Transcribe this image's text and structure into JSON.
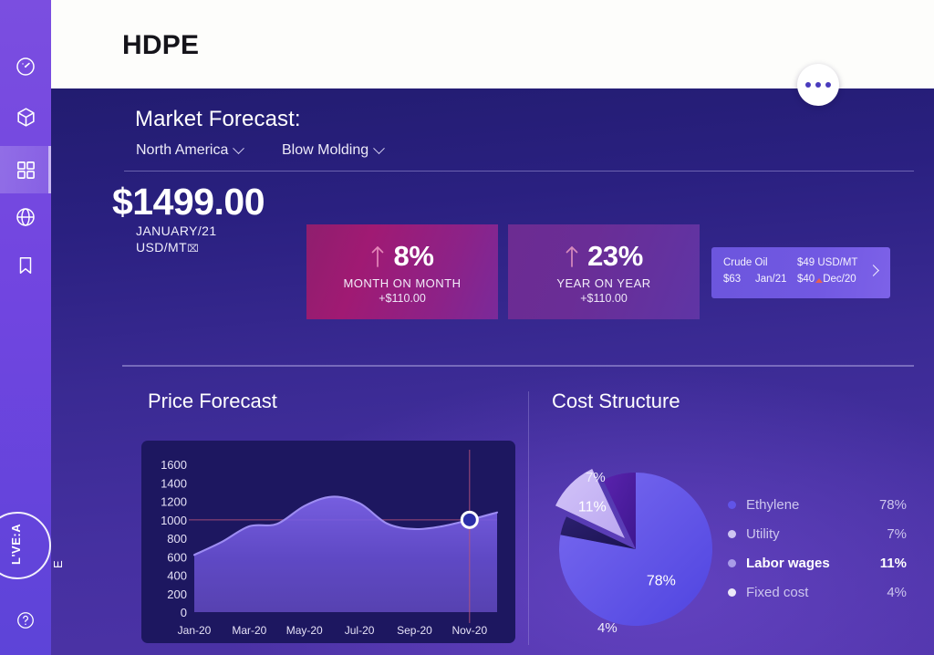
{
  "sidebar": {
    "items": [
      {
        "name": "dashboard",
        "icon": "gauge-icon",
        "active": false
      },
      {
        "name": "products",
        "icon": "cube-icon",
        "active": false
      },
      {
        "name": "grid",
        "icon": "grid-icon",
        "active": true
      },
      {
        "name": "global",
        "icon": "globe-icon",
        "active": false
      },
      {
        "name": "bookmarks",
        "icon": "bookmark-icon",
        "active": false
      }
    ],
    "logo": {
      "line1": "L'VE:A",
      "line2": "E"
    },
    "help_icon": "help-icon"
  },
  "header": {
    "title": "HDPE",
    "more_icon": "more-options-icon"
  },
  "forecast": {
    "title": "Market Forecast:",
    "region": "North America",
    "process": "Blow Molding",
    "price": "$1499.00",
    "period": "JANUARY/21",
    "unit": "USD/MT",
    "unit_glyph": "⌧"
  },
  "metrics": [
    {
      "id": "month-on-month",
      "percent": "8%",
      "label": "MONTH ON MONTH",
      "delta": "+$110.00",
      "direction": "up",
      "color": "#9a1c78"
    },
    {
      "id": "year-on-year",
      "percent": "23%",
      "label": "YEAR ON YEAR",
      "delta": "+$110.00",
      "direction": "up",
      "color": "#67309a"
    }
  ],
  "crude": {
    "name": "Crude Oil",
    "price": "$63",
    "date": "Jan/21",
    "alt_unit": "$49 USD/MT",
    "alt_price": "$40",
    "alt_date": "Dec/20",
    "trend": "up",
    "trend_color": "#e8604f",
    "chevron_icon": "chevron-right-icon"
  },
  "panels": {
    "price_forecast_title": "Price Forecast",
    "cost_structure_title": "Cost Structure"
  },
  "chart_data": [
    {
      "type": "line",
      "title": "Price Forecast",
      "xlabel": "",
      "ylabel": "",
      "ylim": [
        0,
        1700
      ],
      "yticks": [
        0,
        200,
        400,
        600,
        800,
        1000,
        1200,
        1400,
        1600
      ],
      "ytick_labels": [
        "0",
        "200",
        "400",
        "600",
        "800",
        "1000",
        "1200",
        "1400",
        "1600"
      ],
      "xtick_labels": [
        "Jan-20",
        "Mar-20",
        "May-20",
        "Jul-20",
        "Sep-20",
        "Nov-20"
      ],
      "grid": false,
      "series": [
        {
          "name": "Price",
          "color": "#8d7ced",
          "x": [
            "Jan-20",
            "Feb-20",
            "Mar-20",
            "Apr-20",
            "May-20",
            "Jun-20",
            "Jul-20",
            "Aug-20",
            "Sep-20",
            "Oct-20",
            "Nov-20",
            "Dec-20"
          ],
          "values": [
            620,
            760,
            930,
            955,
            1150,
            1250,
            1180,
            960,
            900,
            930,
            1000,
            1080
          ]
        }
      ],
      "reference_line": {
        "value": 1000,
        "color": "#b5547c"
      },
      "marker": {
        "x": "Nov-20",
        "y": 1000,
        "color": "#2b2ea8"
      },
      "cursor_line": {
        "x": "Nov-20",
        "color": "#b5547c"
      }
    },
    {
      "type": "pie",
      "title": "Cost Structure",
      "legend_position": "right",
      "categories": [
        "Ethylene",
        "Utility",
        "Labor wages",
        "Fixed cost"
      ],
      "values": [
        78,
        7,
        11,
        4
      ],
      "value_labels": [
        "78%",
        "7%",
        "11%",
        "4%"
      ],
      "colors": [
        "#6154e8",
        "#4b1f9e",
        "#c7b4f5",
        "#241a5e"
      ],
      "legend": [
        {
          "label": "Ethylene",
          "value": "78%",
          "dot": "#6154e8",
          "highlight": false
        },
        {
          "label": "Utility",
          "value": "7%",
          "dot": "#cec5f2",
          "highlight": false
        },
        {
          "label": "Labor wages",
          "value": "11%",
          "dot": "#a99ce8",
          "highlight": true
        },
        {
          "label": "Fixed cost",
          "value": "4%",
          "dot": "#ece9f8",
          "highlight": false
        }
      ],
      "exploded_slice": "Labor wages"
    }
  ]
}
